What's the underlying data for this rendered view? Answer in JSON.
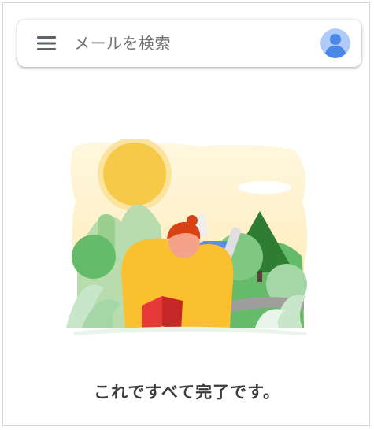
{
  "search": {
    "placeholder": "メールを検索"
  },
  "icons": {
    "menu": "hamburger-menu-icon",
    "account": "account-avatar-icon"
  },
  "colors": {
    "avatar_bg": "#aecbfa",
    "avatar_fg": "#4a87e8",
    "menu_icon": "#5f6368",
    "sun": "#f7c948",
    "hill_green": "#4caf50",
    "tree_dark": "#2e7d32",
    "shirt_yellow": "#fbc02d",
    "book_red": "#e53935"
  },
  "main": {
    "empty_state_message": "これですべて完了です。"
  }
}
